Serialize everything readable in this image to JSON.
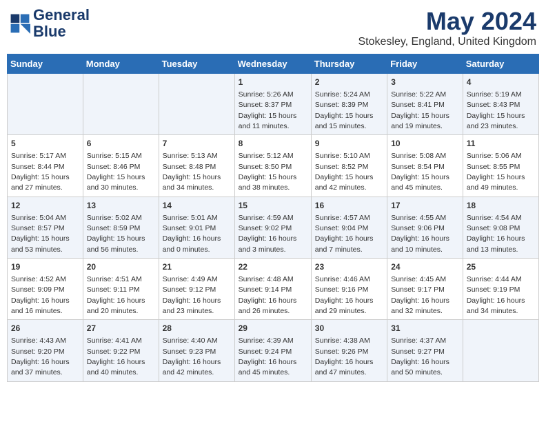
{
  "header": {
    "logo_line1": "General",
    "logo_line2": "Blue",
    "month_year": "May 2024",
    "location": "Stokesley, England, United Kingdom"
  },
  "weekdays": [
    "Sunday",
    "Monday",
    "Tuesday",
    "Wednesday",
    "Thursday",
    "Friday",
    "Saturday"
  ],
  "weeks": [
    [
      {
        "day": "",
        "info": ""
      },
      {
        "day": "",
        "info": ""
      },
      {
        "day": "",
        "info": ""
      },
      {
        "day": "1",
        "info": "Sunrise: 5:26 AM\nSunset: 8:37 PM\nDaylight: 15 hours and 11 minutes."
      },
      {
        "day": "2",
        "info": "Sunrise: 5:24 AM\nSunset: 8:39 PM\nDaylight: 15 hours and 15 minutes."
      },
      {
        "day": "3",
        "info": "Sunrise: 5:22 AM\nSunset: 8:41 PM\nDaylight: 15 hours and 19 minutes."
      },
      {
        "day": "4",
        "info": "Sunrise: 5:19 AM\nSunset: 8:43 PM\nDaylight: 15 hours and 23 minutes."
      }
    ],
    [
      {
        "day": "5",
        "info": "Sunrise: 5:17 AM\nSunset: 8:44 PM\nDaylight: 15 hours and 27 minutes."
      },
      {
        "day": "6",
        "info": "Sunrise: 5:15 AM\nSunset: 8:46 PM\nDaylight: 15 hours and 30 minutes."
      },
      {
        "day": "7",
        "info": "Sunrise: 5:13 AM\nSunset: 8:48 PM\nDaylight: 15 hours and 34 minutes."
      },
      {
        "day": "8",
        "info": "Sunrise: 5:12 AM\nSunset: 8:50 PM\nDaylight: 15 hours and 38 minutes."
      },
      {
        "day": "9",
        "info": "Sunrise: 5:10 AM\nSunset: 8:52 PM\nDaylight: 15 hours and 42 minutes."
      },
      {
        "day": "10",
        "info": "Sunrise: 5:08 AM\nSunset: 8:54 PM\nDaylight: 15 hours and 45 minutes."
      },
      {
        "day": "11",
        "info": "Sunrise: 5:06 AM\nSunset: 8:55 PM\nDaylight: 15 hours and 49 minutes."
      }
    ],
    [
      {
        "day": "12",
        "info": "Sunrise: 5:04 AM\nSunset: 8:57 PM\nDaylight: 15 hours and 53 minutes."
      },
      {
        "day": "13",
        "info": "Sunrise: 5:02 AM\nSunset: 8:59 PM\nDaylight: 15 hours and 56 minutes."
      },
      {
        "day": "14",
        "info": "Sunrise: 5:01 AM\nSunset: 9:01 PM\nDaylight: 16 hours and 0 minutes."
      },
      {
        "day": "15",
        "info": "Sunrise: 4:59 AM\nSunset: 9:02 PM\nDaylight: 16 hours and 3 minutes."
      },
      {
        "day": "16",
        "info": "Sunrise: 4:57 AM\nSunset: 9:04 PM\nDaylight: 16 hours and 7 minutes."
      },
      {
        "day": "17",
        "info": "Sunrise: 4:55 AM\nSunset: 9:06 PM\nDaylight: 16 hours and 10 minutes."
      },
      {
        "day": "18",
        "info": "Sunrise: 4:54 AM\nSunset: 9:08 PM\nDaylight: 16 hours and 13 minutes."
      }
    ],
    [
      {
        "day": "19",
        "info": "Sunrise: 4:52 AM\nSunset: 9:09 PM\nDaylight: 16 hours and 16 minutes."
      },
      {
        "day": "20",
        "info": "Sunrise: 4:51 AM\nSunset: 9:11 PM\nDaylight: 16 hours and 20 minutes."
      },
      {
        "day": "21",
        "info": "Sunrise: 4:49 AM\nSunset: 9:12 PM\nDaylight: 16 hours and 23 minutes."
      },
      {
        "day": "22",
        "info": "Sunrise: 4:48 AM\nSunset: 9:14 PM\nDaylight: 16 hours and 26 minutes."
      },
      {
        "day": "23",
        "info": "Sunrise: 4:46 AM\nSunset: 9:16 PM\nDaylight: 16 hours and 29 minutes."
      },
      {
        "day": "24",
        "info": "Sunrise: 4:45 AM\nSunset: 9:17 PM\nDaylight: 16 hours and 32 minutes."
      },
      {
        "day": "25",
        "info": "Sunrise: 4:44 AM\nSunset: 9:19 PM\nDaylight: 16 hours and 34 minutes."
      }
    ],
    [
      {
        "day": "26",
        "info": "Sunrise: 4:43 AM\nSunset: 9:20 PM\nDaylight: 16 hours and 37 minutes."
      },
      {
        "day": "27",
        "info": "Sunrise: 4:41 AM\nSunset: 9:22 PM\nDaylight: 16 hours and 40 minutes."
      },
      {
        "day": "28",
        "info": "Sunrise: 4:40 AM\nSunset: 9:23 PM\nDaylight: 16 hours and 42 minutes."
      },
      {
        "day": "29",
        "info": "Sunrise: 4:39 AM\nSunset: 9:24 PM\nDaylight: 16 hours and 45 minutes."
      },
      {
        "day": "30",
        "info": "Sunrise: 4:38 AM\nSunset: 9:26 PM\nDaylight: 16 hours and 47 minutes."
      },
      {
        "day": "31",
        "info": "Sunrise: 4:37 AM\nSunset: 9:27 PM\nDaylight: 16 hours and 50 minutes."
      },
      {
        "day": "",
        "info": ""
      }
    ]
  ]
}
